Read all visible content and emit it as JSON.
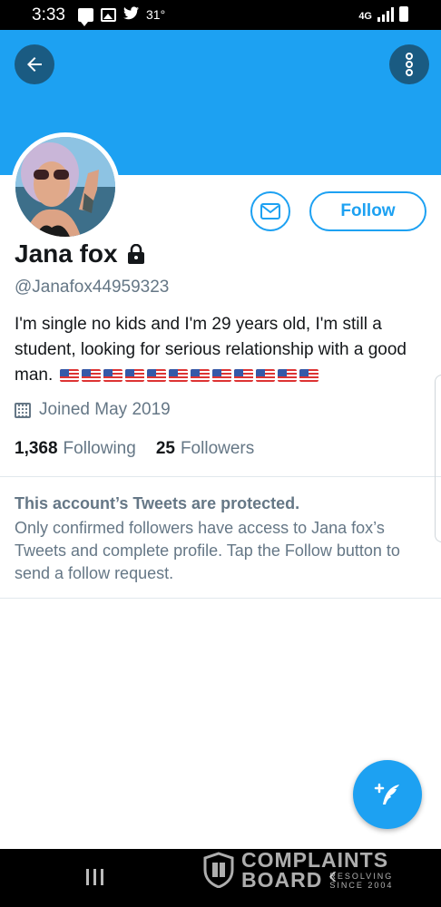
{
  "status_bar": {
    "time": "3:33",
    "temperature": "31°",
    "network": "4G"
  },
  "header": {
    "back_icon": "arrow-left-icon",
    "more_icon": "more-vertical-icon",
    "banner_color": "#1da1f2"
  },
  "actions": {
    "message_icon": "envelope-icon",
    "follow_label": "Follow"
  },
  "profile": {
    "name": "Jana fox",
    "handle": "@Janafox44959323",
    "bio": "I'm single no kids and I'm 29 years old, I'm still a student, looking for serious relationship with a good man.",
    "bio_flag_count": 12,
    "joined": "Joined May 2019",
    "following_count": "1,368",
    "following_label": "Following",
    "followers_count": "25",
    "followers_label": "Followers"
  },
  "protected": {
    "title": "This account’s Tweets are protected.",
    "body": "Only confirmed followers have access to Jana fox’s Tweets and complete profile. Tap the Follow button to send a follow request."
  },
  "fab": {
    "icon": "compose-tweet-icon",
    "color": "#1da1f2"
  },
  "watermark": {
    "line1": "COMPLAINTS",
    "line2": "BOARD",
    "tag1": "RESOLVING",
    "tag2": "SINCE 2004"
  },
  "colors": {
    "accent": "#1da1f2",
    "secondary_text": "#657786",
    "primary_text": "#14171a"
  }
}
